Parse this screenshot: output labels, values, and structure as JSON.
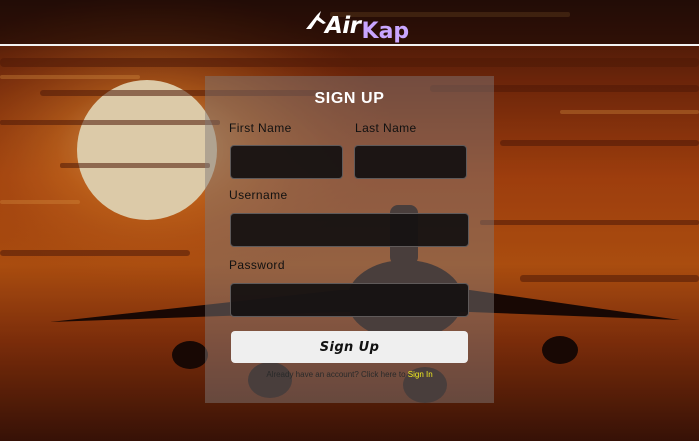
{
  "brand": {
    "name_part1": "Air",
    "name_part2": "Kap",
    "accent_color": "#c9a6ff"
  },
  "form": {
    "title": "SIGN UP",
    "first_name_label": "First Name",
    "last_name_label": "Last Name",
    "username_label": "Username",
    "password_label": "Password",
    "first_name_value": "",
    "last_name_value": "",
    "username_value": "",
    "password_value": "",
    "submit_label": "Sign Up",
    "signin_prompt": "Already have an account? Click here to",
    "signin_link": "Sign In",
    "link_color": "#f1ec1f"
  },
  "icons": {
    "logo": "airplane-logo-icon"
  }
}
